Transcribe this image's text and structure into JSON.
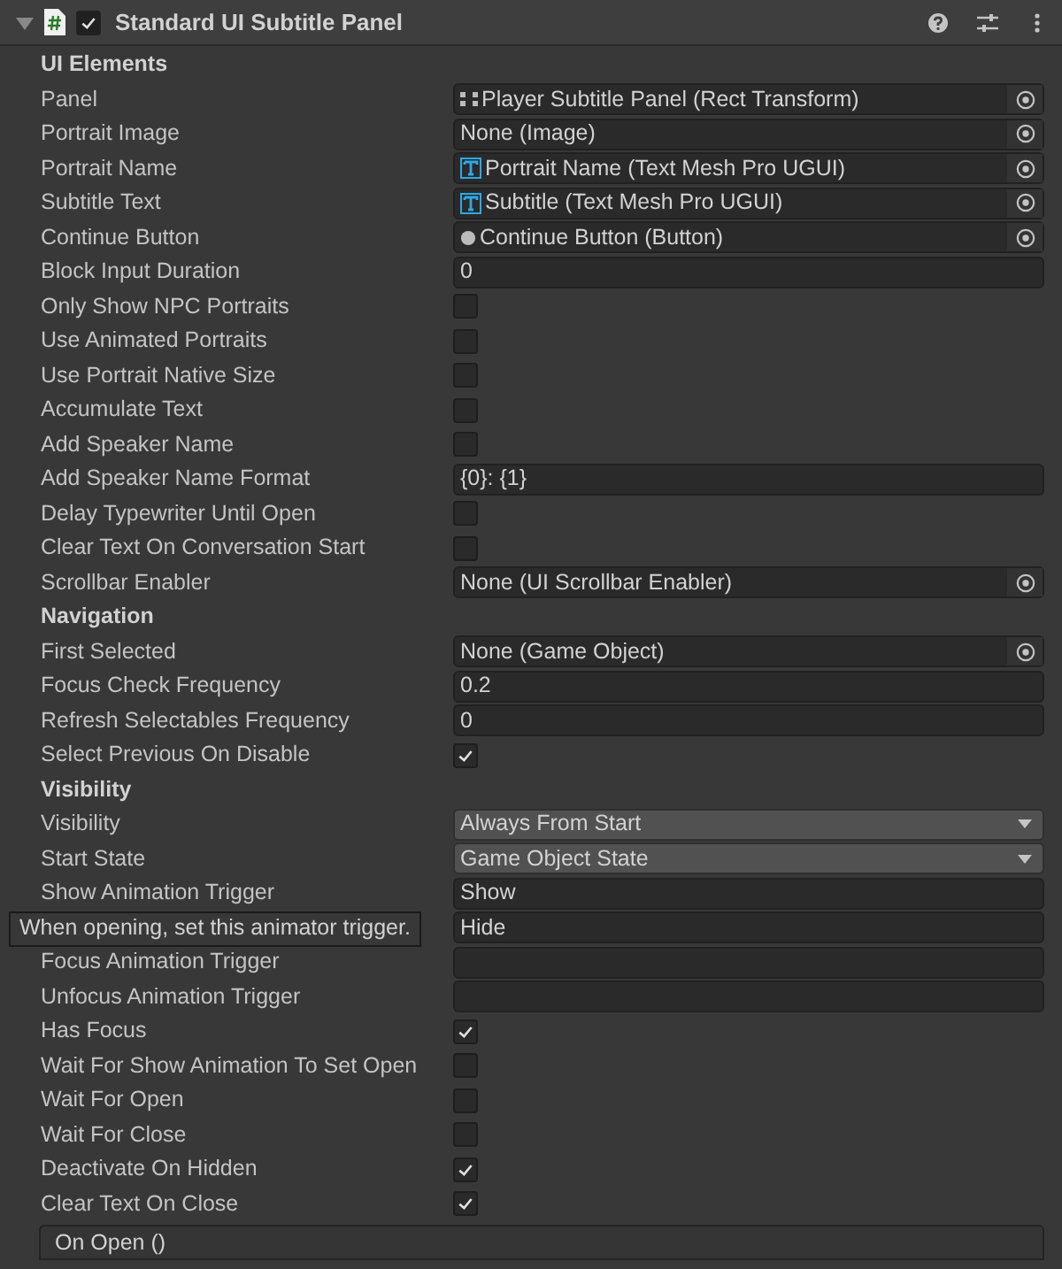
{
  "component": {
    "title": "Standard UI Subtitle Panel",
    "enabled": true,
    "expanded": true
  },
  "sections": [
    {
      "title": "UI Elements",
      "fields": [
        {
          "label": "Panel",
          "kind": "object-rect",
          "value": "Player Subtitle Panel (Rect Transform)"
        },
        {
          "label": "Portrait Image",
          "kind": "object",
          "value": "None (Image)"
        },
        {
          "label": "Portrait Name",
          "kind": "object-text",
          "value": "Portrait Name (Text Mesh Pro UGUI)"
        },
        {
          "label": "Subtitle Text",
          "kind": "object-text",
          "value": "Subtitle (Text Mesh Pro UGUI)"
        },
        {
          "label": "Continue Button",
          "kind": "object-button",
          "value": "Continue Button (Button)"
        },
        {
          "label": "Block Input Duration",
          "kind": "text",
          "value": "0"
        },
        {
          "label": "Only Show NPC Portraits",
          "kind": "checkbox",
          "checked": false
        },
        {
          "label": "Use Animated Portraits",
          "kind": "checkbox",
          "checked": false
        },
        {
          "label": "Use Portrait Native Size",
          "kind": "checkbox",
          "checked": false
        },
        {
          "label": "Accumulate Text",
          "kind": "checkbox",
          "checked": false
        },
        {
          "label": "Add Speaker Name",
          "kind": "checkbox",
          "checked": false
        },
        {
          "label": "Add Speaker Name Format",
          "kind": "text",
          "value": "{0}: {1}"
        },
        {
          "label": "Delay Typewriter Until Open",
          "kind": "checkbox",
          "checked": false
        },
        {
          "label": "Clear Text On Conversation Start",
          "kind": "checkbox",
          "checked": false
        },
        {
          "label": "Scrollbar Enabler",
          "kind": "object",
          "value": "None (UI Scrollbar Enabler)"
        }
      ]
    },
    {
      "title": "Navigation",
      "fields": [
        {
          "label": "First Selected",
          "kind": "object",
          "value": "None (Game Object)"
        },
        {
          "label": "Focus Check Frequency",
          "kind": "text",
          "value": "0.2"
        },
        {
          "label": "Refresh Selectables Frequency",
          "kind": "text",
          "value": "0"
        },
        {
          "label": "Select Previous On Disable",
          "kind": "checkbox",
          "checked": true
        }
      ]
    },
    {
      "title": "Visibility",
      "fields": [
        {
          "label": "Visibility",
          "kind": "dropdown",
          "value": "Always From Start"
        },
        {
          "label": "Start State",
          "kind": "dropdown",
          "value": "Game Object State"
        },
        {
          "label": "Show Animation Trigger",
          "kind": "text",
          "value": "Show"
        },
        {
          "kind": "text",
          "value": "Hide",
          "tooltip": "When opening, set this animator trigger."
        },
        {
          "label": "Focus Animation Trigger",
          "kind": "text"
        },
        {
          "label": "Unfocus Animation Trigger",
          "kind": "text"
        },
        {
          "label": "Has Focus",
          "kind": "checkbox",
          "checked": true
        },
        {
          "label": "Wait For Show Animation To Set Open",
          "kind": "checkbox",
          "checked": false
        },
        {
          "label": "Wait For Open",
          "kind": "checkbox",
          "checked": false
        },
        {
          "label": "Wait For Close",
          "kind": "checkbox",
          "checked": false
        },
        {
          "label": "Deactivate On Hidden",
          "kind": "checkbox",
          "checked": true
        },
        {
          "label": "Clear Text On Close",
          "kind": "checkbox",
          "checked": true
        }
      ]
    }
  ],
  "event": {
    "title": "On Open ()"
  }
}
